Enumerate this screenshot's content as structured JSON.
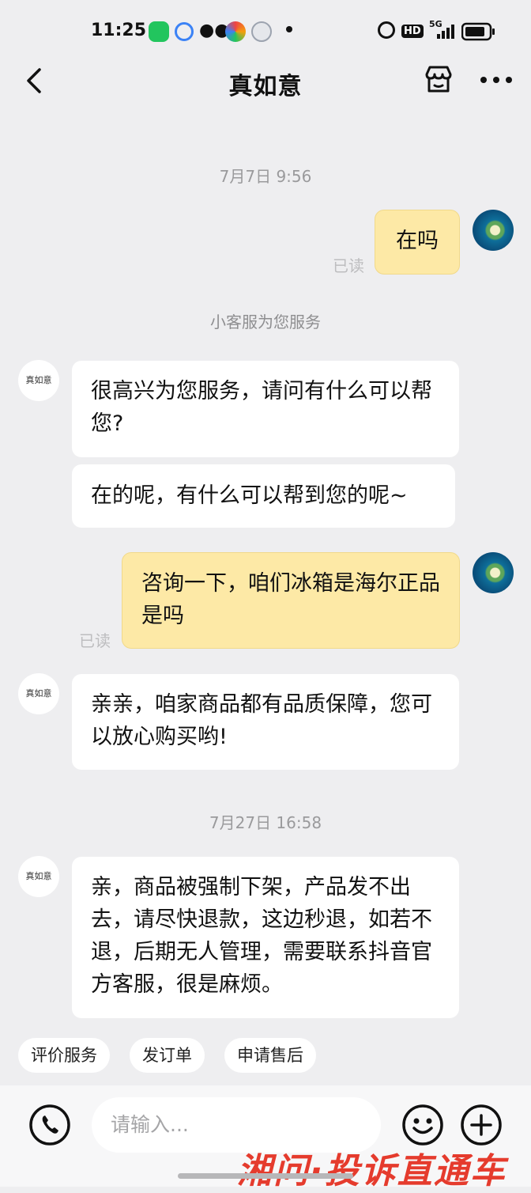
{
  "status_bar": {
    "time": "11:25",
    "hd": "HD",
    "net": "5G"
  },
  "header": {
    "title": "真如意"
  },
  "chat": {
    "ts1": "7月7日 9:56",
    "msg_me1": "在吗",
    "read1": "已读",
    "system1": "小客服为您服务",
    "shop_avatar": "真如意",
    "msg_shop1": "很高兴为您服务，请问有什么可以帮您?",
    "msg_shop2": "在的呢，有什么可以帮到您的呢~",
    "msg_me2": "咨询一下，咱们冰箱是海尔正品是吗",
    "read2": "已读",
    "msg_shop3": "亲亲，咱家商品都有品质保障，您可以放心购买哟!",
    "ts2": "7月27日 16:58",
    "msg_shop4": "亲，商品被强制下架，产品发不出去，请尽快退款，这边秒退，如若不退，后期无人管理，需要联系抖音官方客服，很是麻烦。"
  },
  "quick_actions": [
    "评价服务",
    "发订单",
    "申请售后"
  ],
  "input": {
    "placeholder": "请输入..."
  },
  "watermark": "湘问·投诉直通车",
  "colors": {
    "mine_bubble": "#fde9a6",
    "background": "#eeeef0",
    "watermark": "#e53b2d"
  }
}
